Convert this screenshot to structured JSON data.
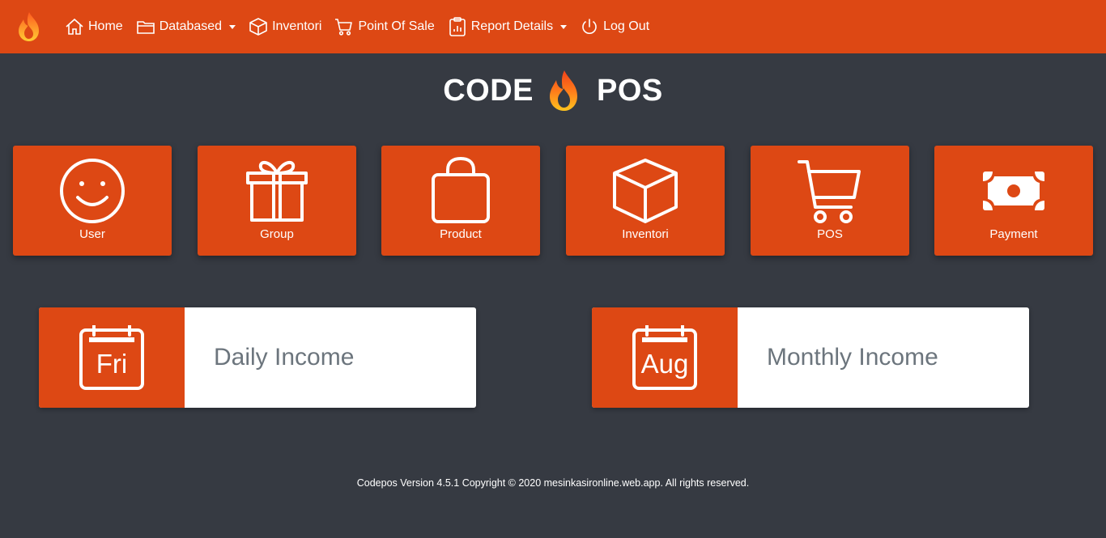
{
  "nav": {
    "brand_icon": "flame-logo-icon",
    "items": [
      {
        "label": "Home",
        "icon": "home-icon"
      },
      {
        "label": "Databased",
        "icon": "folder-icon",
        "dropdown": true
      },
      {
        "label": "Inventori",
        "icon": "box-icon"
      },
      {
        "label": "Point Of Sale",
        "icon": "cart-icon"
      },
      {
        "label": "Report Details",
        "icon": "clipboard-chart-icon",
        "dropdown": true
      },
      {
        "label": "Log Out",
        "icon": "power-icon"
      }
    ]
  },
  "title": {
    "left": "CODE",
    "right": "POS"
  },
  "tiles": [
    {
      "label": "User",
      "icon": "smiley-icon"
    },
    {
      "label": "Group",
      "icon": "gift-icon"
    },
    {
      "label": "Product",
      "icon": "shopping-bag-icon"
    },
    {
      "label": "Inventori",
      "icon": "box-icon"
    },
    {
      "label": "POS",
      "icon": "cart-icon"
    },
    {
      "label": "Payment",
      "icon": "money-icon"
    }
  ],
  "cards": [
    {
      "label": "Daily Income",
      "calendar_text": "Fri",
      "icon": "calendar-icon"
    },
    {
      "label": "Monthly Income",
      "calendar_text": "Aug",
      "icon": "calendar-icon"
    }
  ],
  "footer": {
    "text": "Codepos Version 4.5.1 Copyright © 2020 mesinkasironline.web.app. All rights reserved."
  },
  "colors": {
    "accent": "#dd4814",
    "background": "#363a42",
    "card": "#ffffff",
    "muted_text": "#6c757d"
  }
}
